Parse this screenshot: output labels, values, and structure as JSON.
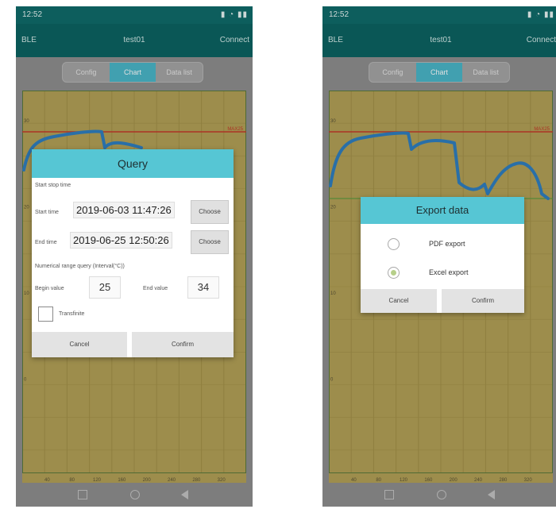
{
  "status_bar": {
    "time": "12:52",
    "icons": "▮ ◔ ▮▮"
  },
  "app_bar": {
    "left": "BLE",
    "title": "test01",
    "right": "Connect"
  },
  "tabs": [
    "Config",
    "Chart",
    "Data list"
  ],
  "active_tab": "Chart",
  "chart": {
    "limit_label": "MAX25",
    "x_ticks": [
      "40",
      "80",
      "120",
      "160",
      "200",
      "240",
      "280",
      "320"
    ],
    "y_ticks": [
      "30",
      "20",
      "10",
      "0"
    ],
    "colors": {
      "line": "#2f7fc0",
      "limit": "#c43b2a",
      "bg": "#b3a157",
      "grid": "#a39149",
      "border": "#5b7a3c"
    }
  },
  "query_dialog": {
    "title": "Query",
    "section_label": "Start stop time",
    "start_label": "Start time",
    "start_value": "2019-06-03 11:47:26",
    "end_label": "End time",
    "end_value": "2019-06-25 12:50:26",
    "choose_label": "Choose",
    "range_section_label": "Numerical range query (Interval(°C))",
    "begin_label": "Begin value",
    "begin_value": "25",
    "end_value_label": "End value",
    "end_number": "34",
    "checkbox_label": "Transfinite",
    "cancel_label": "Cancel",
    "confirm_label": "Confirm"
  },
  "export_dialog": {
    "title": "Export data",
    "options": [
      {
        "label": "PDF export",
        "selected": false
      },
      {
        "label": "Excel export",
        "selected": true
      }
    ],
    "cancel_label": "Cancel",
    "confirm_label": "Confirm"
  }
}
